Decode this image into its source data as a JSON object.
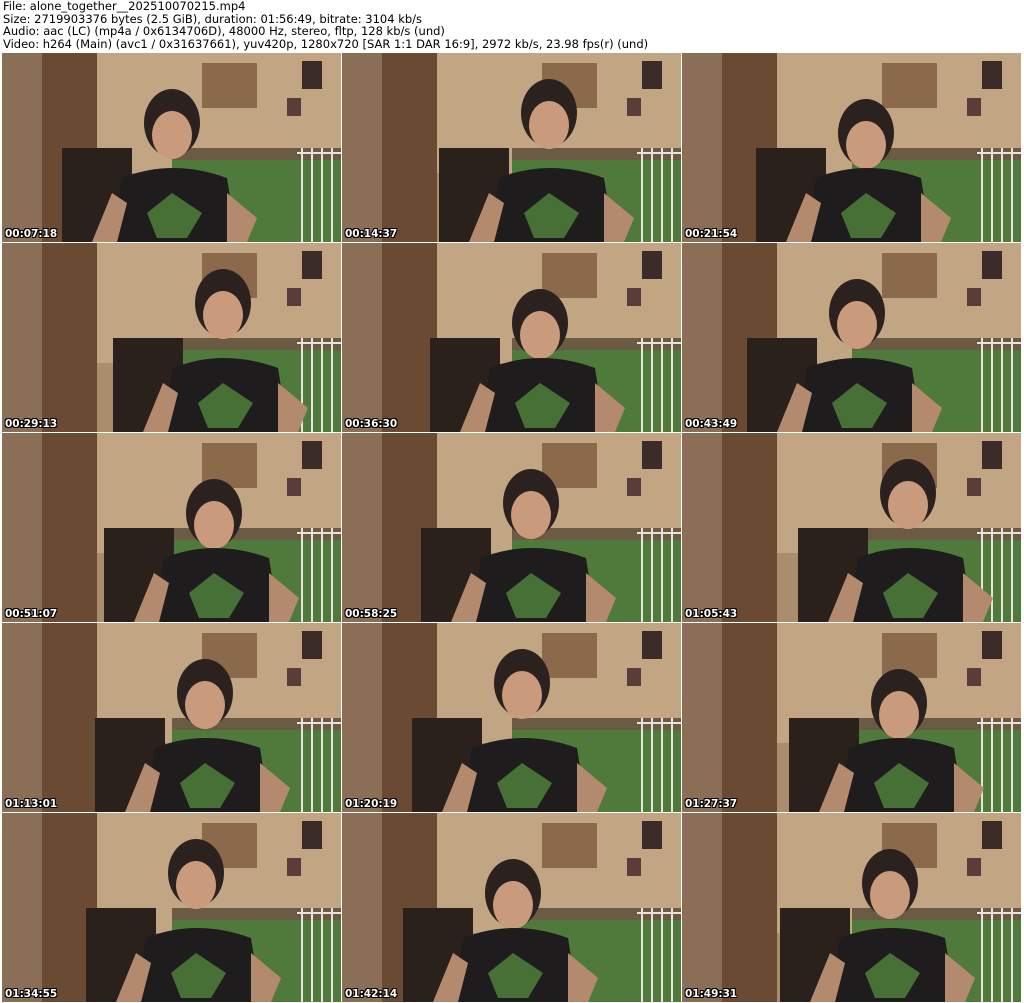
{
  "header": {
    "line1": "File: alone_together__202510070215.mp4",
    "line2": "Size: 2719903376 bytes (2.5 GiB), duration: 01:56:49, bitrate: 3104 kb/s",
    "line3": "Audio: aac (LC) (mp4a / 0x6134706D), 48000 Hz, stereo, fltp, 128 kb/s (und)",
    "line4": "Video: h264 (Main) (avc1 / 0x31637661), yuv420p, 1280x720 [SAR 1:1 DAR 16:9], 2972 kb/s, 23.98 fps(r) (und)"
  },
  "thumbnails": [
    {
      "timestamp": "00:07:18"
    },
    {
      "timestamp": "00:14:37"
    },
    {
      "timestamp": "00:21:54"
    },
    {
      "timestamp": "00:29:13"
    },
    {
      "timestamp": "00:36:30"
    },
    {
      "timestamp": "00:43:49"
    },
    {
      "timestamp": "00:51:07"
    },
    {
      "timestamp": "00:58:25"
    },
    {
      "timestamp": "01:05:43"
    },
    {
      "timestamp": "01:13:01"
    },
    {
      "timestamp": "01:20:19"
    },
    {
      "timestamp": "01:27:37"
    },
    {
      "timestamp": "01:34:55"
    },
    {
      "timestamp": "01:42:14"
    },
    {
      "timestamp": "01:49:31"
    }
  ]
}
